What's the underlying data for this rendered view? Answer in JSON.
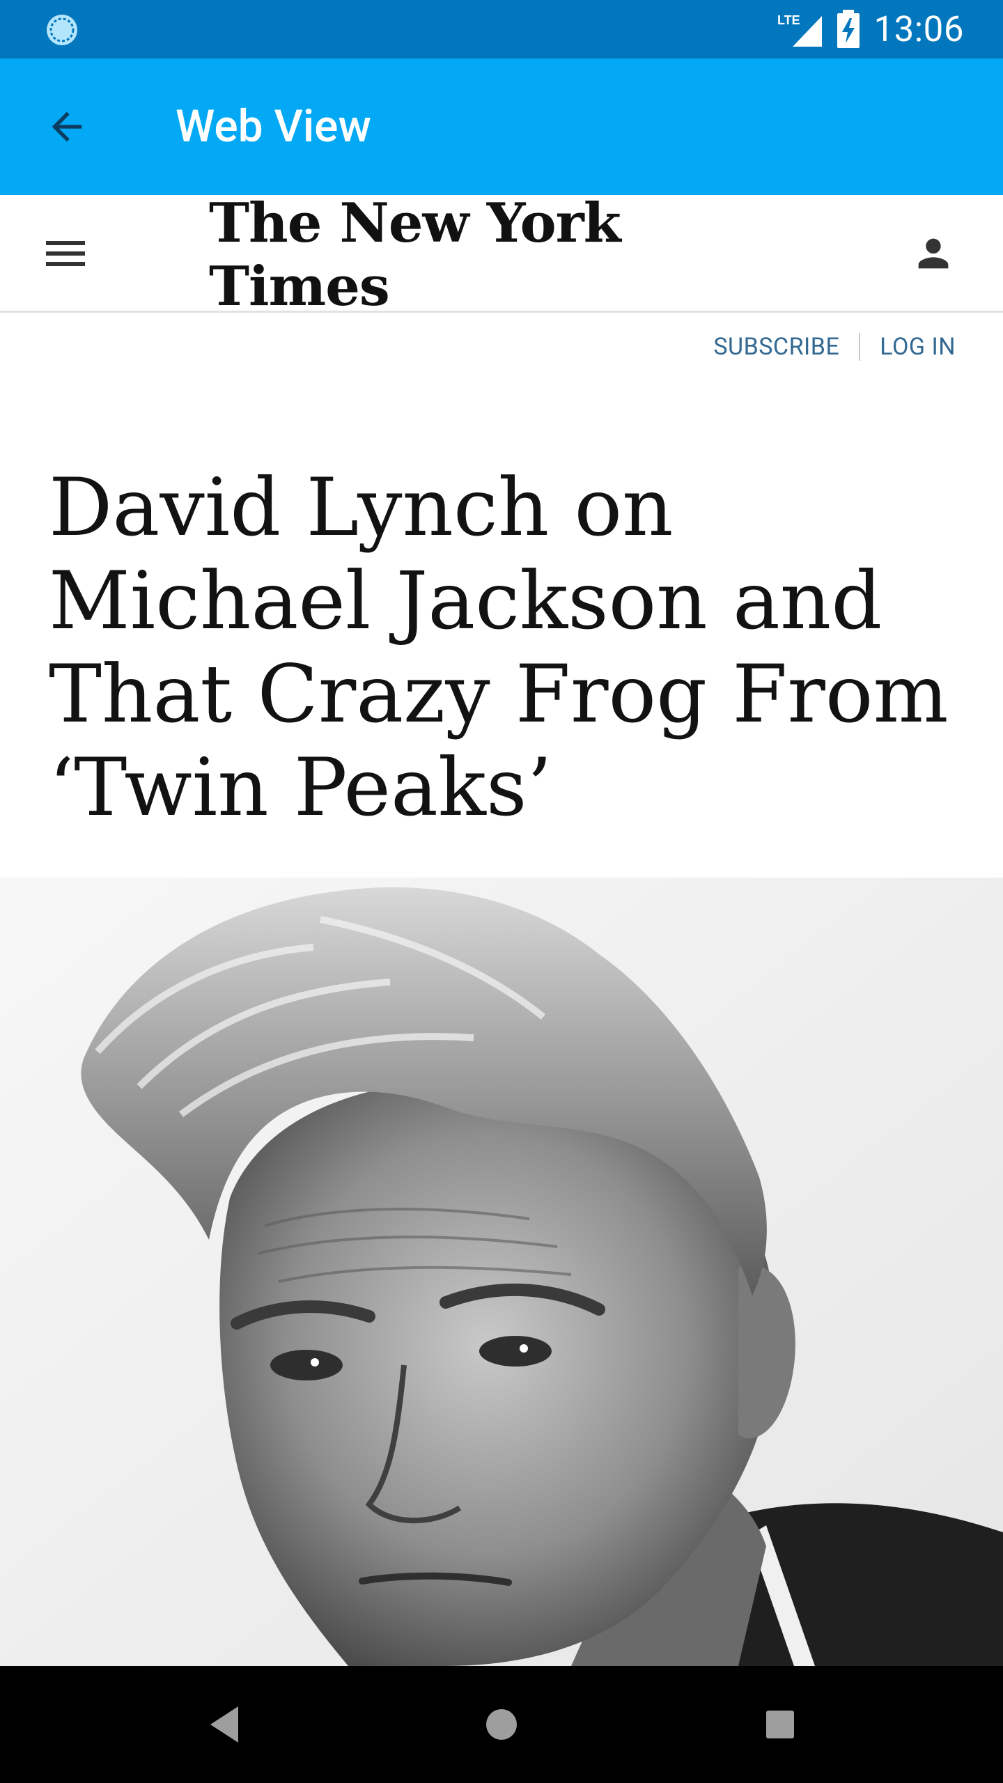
{
  "status_bar": {
    "network": "LTE",
    "time": "13:06",
    "icons": [
      "sync-icon",
      "lte-signal-icon",
      "battery-charging-icon"
    ]
  },
  "app_bar": {
    "title": "Web View",
    "back_icon": "arrow-back-icon"
  },
  "nyt_header": {
    "logo_text": "The New York Times",
    "menu_icon": "hamburger-menu-icon",
    "user_icon": "user-account-icon"
  },
  "account_links": {
    "subscribe": "SUBSCRIBE",
    "login": "LOG IN"
  },
  "article": {
    "headline": "David Lynch on Michael Jackson and That Crazy Frog From ‘Twin Peaks’",
    "photo_icon": "portrait-photo"
  },
  "nav_bar": {
    "icons": [
      "nav-back-icon",
      "nav-home-icon",
      "nav-recents-icon"
    ]
  },
  "colors": {
    "status_bar": "#0277bd",
    "app_bar": "#03a9f4",
    "link": "#326891",
    "headline": "#121212"
  }
}
